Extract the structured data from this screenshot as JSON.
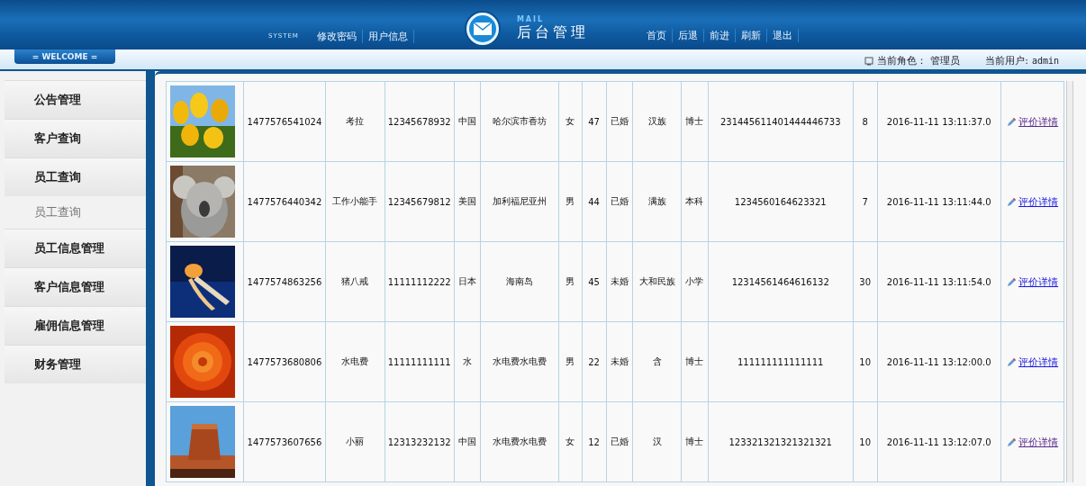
{
  "header": {
    "system_label": "SYSTEM",
    "left_nav": [
      "修改密码",
      "用户信息"
    ],
    "logo_text": "MAIL",
    "title": "后台管理",
    "right_nav": [
      "首页",
      "后退",
      "前进",
      "刷新",
      "退出"
    ]
  },
  "welcome_bar": {
    "welcome": "= WELCOME =",
    "role_label": "当前角色：",
    "role": "管理员",
    "user_label": "当前用户:",
    "user": "admin"
  },
  "sidebar": {
    "items": [
      {
        "label": "公告管理",
        "kind": "group"
      },
      {
        "label": "客户查询",
        "kind": "group"
      },
      {
        "label": "员工查询",
        "kind": "group"
      },
      {
        "label": "员工查询",
        "kind": "sub"
      },
      {
        "label": "员工信息管理",
        "kind": "group"
      },
      {
        "label": "客户信息管理",
        "kind": "group"
      },
      {
        "label": "雇佣信息管理",
        "kind": "group"
      },
      {
        "label": "财务管理",
        "kind": "group"
      }
    ]
  },
  "table": {
    "rows": [
      {
        "cells": [
          "1477576541024",
          "考拉",
          "12345678932",
          "中国",
          "哈尔滨市香坊",
          "女",
          "47",
          "已婚",
          "汉族",
          "博士",
          "231445611401444446733",
          "8",
          "2016-11-11  13:11:37.0"
        ],
        "link": {
          "label": "评价详情",
          "visited": true
        }
      },
      {
        "cells": [
          "1477576440342",
          "工作小能手",
          "12345679812",
          "美国",
          "加利福尼亚州",
          "男",
          "44",
          "已婚",
          "满族",
          "本科",
          "1234560164623321",
          "7",
          "2016-11-11  13:11:44.0"
        ],
        "link": {
          "label": "评价详情",
          "visited": false
        }
      },
      {
        "cells": [
          "1477574863256",
          "猪八戒",
          "11111112222",
          "日本",
          "海南岛",
          "男",
          "45",
          "未婚",
          "大和民族",
          "小学",
          "12314561464616132",
          "30",
          "2016-11-11  13:11:54.0"
        ],
        "link": {
          "label": "评价详情",
          "visited": false
        }
      },
      {
        "cells": [
          "1477573680806",
          "水电费",
          "11111111111",
          "水",
          "水电费水电费",
          "男",
          "22",
          "未婚",
          "含",
          "博士",
          "111111111111111",
          "10",
          "2016-11-11  13:12:00.0"
        ],
        "link": {
          "label": "评价详情",
          "visited": false
        }
      },
      {
        "cells": [
          "1477573607656",
          "小丽",
          "12313232132",
          "中国",
          "水电费水电费",
          "女",
          "12",
          "已婚",
          "汉",
          "博士",
          "123321321321321321",
          "10",
          "2016-11-11  13:12:07.0"
        ],
        "link": {
          "label": "评价详情",
          "visited": true
        }
      }
    ]
  }
}
